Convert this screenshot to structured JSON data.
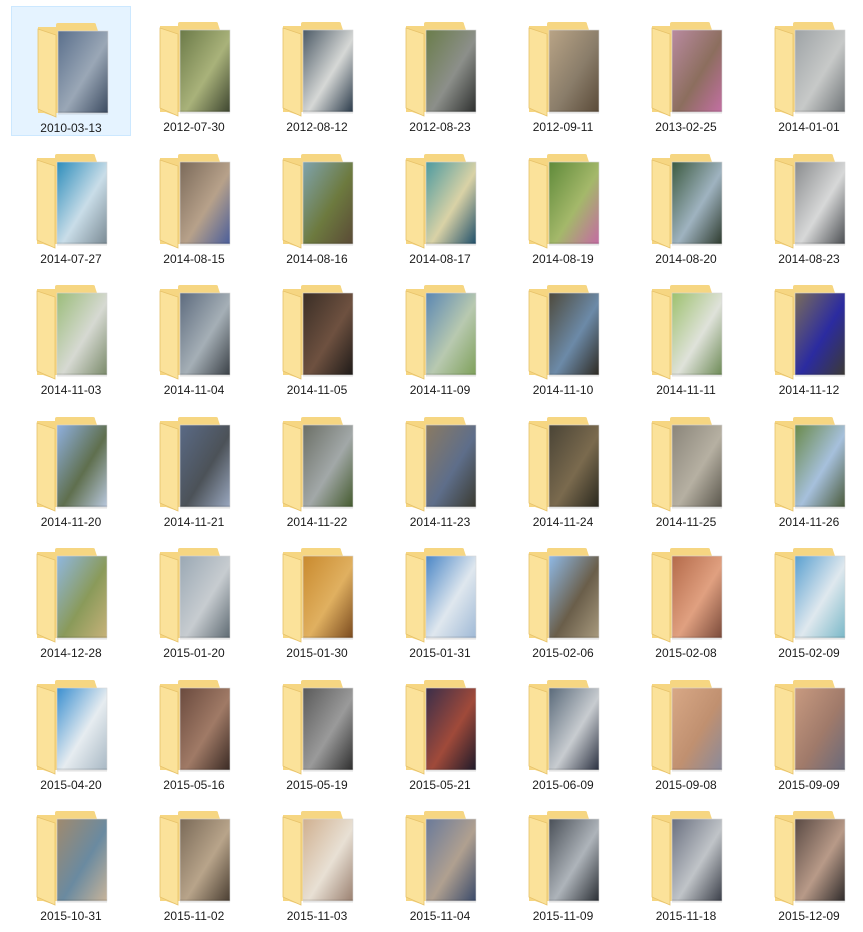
{
  "view": {
    "mode": "large-icons",
    "selected_index": 0
  },
  "folder_colors": {
    "back": "#f6d682",
    "front": "#fbe29a",
    "edge": "#e7c26a"
  },
  "folders": [
    {
      "name": "2010-03-13",
      "icon": "folder-photo-icon",
      "preview": [
        "#5a6f8c",
        "#9aa7b6",
        "#3b4a60"
      ]
    },
    {
      "name": "2012-07-30",
      "icon": "folder-photo-icon",
      "preview": [
        "#6b7a48",
        "#a9b27a",
        "#3e4630"
      ]
    },
    {
      "name": "2012-08-12",
      "icon": "folder-photo-icon",
      "preview": [
        "#4c5a66",
        "#d6d8d6",
        "#2a3a4a"
      ]
    },
    {
      "name": "2012-08-23",
      "icon": "folder-photo-icon",
      "preview": [
        "#6a7d4a",
        "#8c8f8a",
        "#2d2f2e"
      ]
    },
    {
      "name": "2012-09-11",
      "icon": "folder-photo-icon",
      "preview": [
        "#b9a486",
        "#8a7d6a",
        "#5a4a38"
      ]
    },
    {
      "name": "2013-02-25",
      "icon": "folder-photo-icon",
      "preview": [
        "#b98aa0",
        "#8c6e5e",
        "#c36fa3"
      ]
    },
    {
      "name": "2014-01-01",
      "icon": "folder-photo-icon",
      "preview": [
        "#9ea3a6",
        "#c7c9c8",
        "#6f7477"
      ]
    },
    {
      "name": "2014-07-27",
      "icon": "folder-photo-icon",
      "preview": [
        "#2d8dbb",
        "#c9dde8",
        "#7a8a94"
      ]
    },
    {
      "name": "2014-08-15",
      "icon": "folder-photo-icon",
      "preview": [
        "#7b6a5a",
        "#b7a18a",
        "#4a5d9a"
      ]
    },
    {
      "name": "2014-08-16",
      "icon": "folder-photo-icon",
      "preview": [
        "#7fa3ad",
        "#6d7a3f",
        "#5a4a36"
      ]
    },
    {
      "name": "2014-08-17",
      "icon": "folder-photo-icon",
      "preview": [
        "#4d9aa0",
        "#d9d2a6",
        "#1f4f6a"
      ]
    },
    {
      "name": "2014-08-19",
      "icon": "folder-photo-icon",
      "preview": [
        "#5f8a3a",
        "#a4b86a",
        "#c46aa3"
      ]
    },
    {
      "name": "2014-08-20",
      "icon": "folder-photo-icon",
      "preview": [
        "#3c5a40",
        "#9fb3c0",
        "#2e3b2e"
      ]
    },
    {
      "name": "2014-08-23",
      "icon": "folder-photo-icon",
      "preview": [
        "#8a8c8e",
        "#d7d8d8",
        "#4b4e52"
      ]
    },
    {
      "name": "2014-11-03",
      "icon": "folder-photo-icon",
      "preview": [
        "#9bbd7a",
        "#d6d9d2",
        "#7a8a6a"
      ]
    },
    {
      "name": "2014-11-04",
      "icon": "folder-photo-icon",
      "preview": [
        "#5d6b7e",
        "#a5afb6",
        "#3a4046"
      ]
    },
    {
      "name": "2014-11-05",
      "icon": "folder-photo-icon",
      "preview": [
        "#3a2e26",
        "#6e5140",
        "#1e1a18"
      ]
    },
    {
      "name": "2014-11-09",
      "icon": "folder-photo-icon",
      "preview": [
        "#5b87b3",
        "#b8c9b0",
        "#7ea05a"
      ]
    },
    {
      "name": "2014-11-10",
      "icon": "folder-photo-icon",
      "preview": [
        "#4e4a3c",
        "#6c8aa8",
        "#2e2a22"
      ]
    },
    {
      "name": "2014-11-11",
      "icon": "folder-photo-icon",
      "preview": [
        "#9dc16e",
        "#dfe2da",
        "#6d8a56"
      ]
    },
    {
      "name": "2014-11-12",
      "icon": "folder-photo-icon",
      "preview": [
        "#7a6d5a",
        "#2b2ba0",
        "#3c3a34"
      ]
    },
    {
      "name": "2014-11-20",
      "icon": "folder-photo-icon",
      "preview": [
        "#8fb0e0",
        "#5f6f4e",
        "#b9c8de"
      ]
    },
    {
      "name": "2014-11-21",
      "icon": "folder-photo-icon",
      "preview": [
        "#5a6a86",
        "#4c5258",
        "#9aa8c0"
      ]
    },
    {
      "name": "2014-11-22",
      "icon": "folder-photo-icon",
      "preview": [
        "#6b6f66",
        "#a2a8a8",
        "#445a2e"
      ]
    },
    {
      "name": "2014-11-23",
      "icon": "folder-photo-icon",
      "preview": [
        "#8a7a62",
        "#5e6e8a",
        "#3a3a30"
      ]
    },
    {
      "name": "2014-11-24",
      "icon": "folder-photo-icon",
      "preview": [
        "#4a4436",
        "#7a6a4e",
        "#2a281e"
      ]
    },
    {
      "name": "2014-11-25",
      "icon": "folder-photo-icon",
      "preview": [
        "#8a857a",
        "#b6b0a2",
        "#5a564c"
      ]
    },
    {
      "name": "2014-11-26",
      "icon": "folder-photo-icon",
      "preview": [
        "#6a8a4a",
        "#a6c0dc",
        "#4a5a3a"
      ]
    },
    {
      "name": "2014-12-28",
      "icon": "folder-photo-icon",
      "preview": [
        "#8fb7e0",
        "#8a9a5a",
        "#c7b27a"
      ]
    },
    {
      "name": "2015-01-20",
      "icon": "folder-photo-icon",
      "preview": [
        "#9aa8b4",
        "#c7ccd0",
        "#5e6a72"
      ]
    },
    {
      "name": "2015-01-30",
      "icon": "folder-photo-icon",
      "preview": [
        "#c98a2e",
        "#e0b060",
        "#7a4a1e"
      ]
    },
    {
      "name": "2015-01-31",
      "icon": "folder-photo-icon",
      "preview": [
        "#4a86c6",
        "#dfe7ee",
        "#9fb9d6"
      ]
    },
    {
      "name": "2015-02-06",
      "icon": "folder-photo-icon",
      "preview": [
        "#8fb9e6",
        "#6a5e4a",
        "#a89a7e"
      ]
    },
    {
      "name": "2015-02-08",
      "icon": "folder-photo-icon",
      "preview": [
        "#b46a4a",
        "#e0a080",
        "#7a4a3a"
      ]
    },
    {
      "name": "2015-02-09",
      "icon": "folder-photo-icon",
      "preview": [
        "#5aa0d0",
        "#dfe8ee",
        "#7ab8c8"
      ]
    },
    {
      "name": "2015-04-20",
      "icon": "folder-photo-icon",
      "preview": [
        "#3a8fd0",
        "#e6ecf0",
        "#a8b8c4"
      ]
    },
    {
      "name": "2015-05-16",
      "icon": "folder-photo-icon",
      "preview": [
        "#6a4a3e",
        "#a07a66",
        "#3a2a24"
      ]
    },
    {
      "name": "2015-05-19",
      "icon": "folder-photo-icon",
      "preview": [
        "#5a5a5a",
        "#9a9a9a",
        "#2e2e2e"
      ]
    },
    {
      "name": "2015-05-21",
      "icon": "folder-photo-icon",
      "preview": [
        "#3a2e4a",
        "#a04a3a",
        "#1e1a2a"
      ]
    },
    {
      "name": "2015-06-09",
      "icon": "folder-photo-icon",
      "preview": [
        "#5a6a7a",
        "#c8ccd0",
        "#2a3040"
      ]
    },
    {
      "name": "2015-09-08",
      "icon": "folder-photo-icon",
      "preview": [
        "#d8a886",
        "#c09070",
        "#8a8a9a"
      ]
    },
    {
      "name": "2015-09-09",
      "icon": "folder-photo-icon",
      "preview": [
        "#c89a80",
        "#a07a6a",
        "#6a6a7a"
      ]
    },
    {
      "name": "2015-10-31",
      "icon": "folder-photo-icon",
      "preview": [
        "#a08a6e",
        "#6a8aa0",
        "#c8b49a"
      ]
    },
    {
      "name": "2015-11-02",
      "icon": "folder-photo-icon",
      "preview": [
        "#7a6a58",
        "#b8a48a",
        "#4a3e32"
      ]
    },
    {
      "name": "2015-11-03",
      "icon": "folder-photo-icon",
      "preview": [
        "#d0b090",
        "#e8e0d4",
        "#9a8070"
      ]
    },
    {
      "name": "2015-11-04",
      "icon": "folder-photo-icon",
      "preview": [
        "#6a7a9a",
        "#b0a090",
        "#3a4a6a"
      ]
    },
    {
      "name": "2015-11-09",
      "icon": "folder-photo-icon",
      "preview": [
        "#4a5058",
        "#aeb4ba",
        "#2a2e34"
      ]
    },
    {
      "name": "2015-11-18",
      "icon": "folder-photo-icon",
      "preview": [
        "#6a7080",
        "#c0c4c8",
        "#3a3e48"
      ]
    },
    {
      "name": "2015-12-09",
      "icon": "folder-photo-icon",
      "preview": [
        "#5a4a44",
        "#b89a88",
        "#2e2a2a"
      ]
    }
  ]
}
